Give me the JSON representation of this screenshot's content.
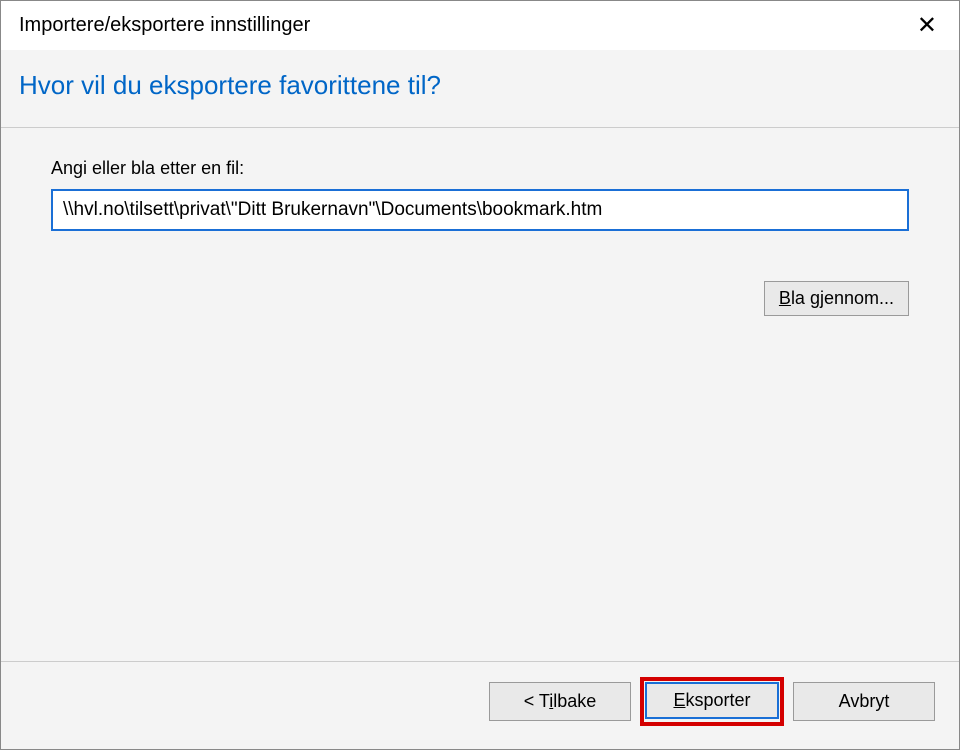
{
  "titlebar": {
    "title": "Importere/eksportere innstillinger"
  },
  "header": {
    "heading": "Hvor vil du eksportere favorittene til?"
  },
  "content": {
    "field_label": "Angi eller bla etter en fil:",
    "path_value": "\\\\hvl.no\\tilsett\\privat\\\"Ditt Brukernavn\"\\Documents\\bookmark.htm",
    "browse_prefix": "B",
    "browse_rest": "la gjennom..."
  },
  "footer": {
    "back_prefix": "< T",
    "back_underline": "i",
    "back_rest": "lbake",
    "export_underline": "E",
    "export_rest": "ksporter",
    "cancel": "Avbryt"
  }
}
